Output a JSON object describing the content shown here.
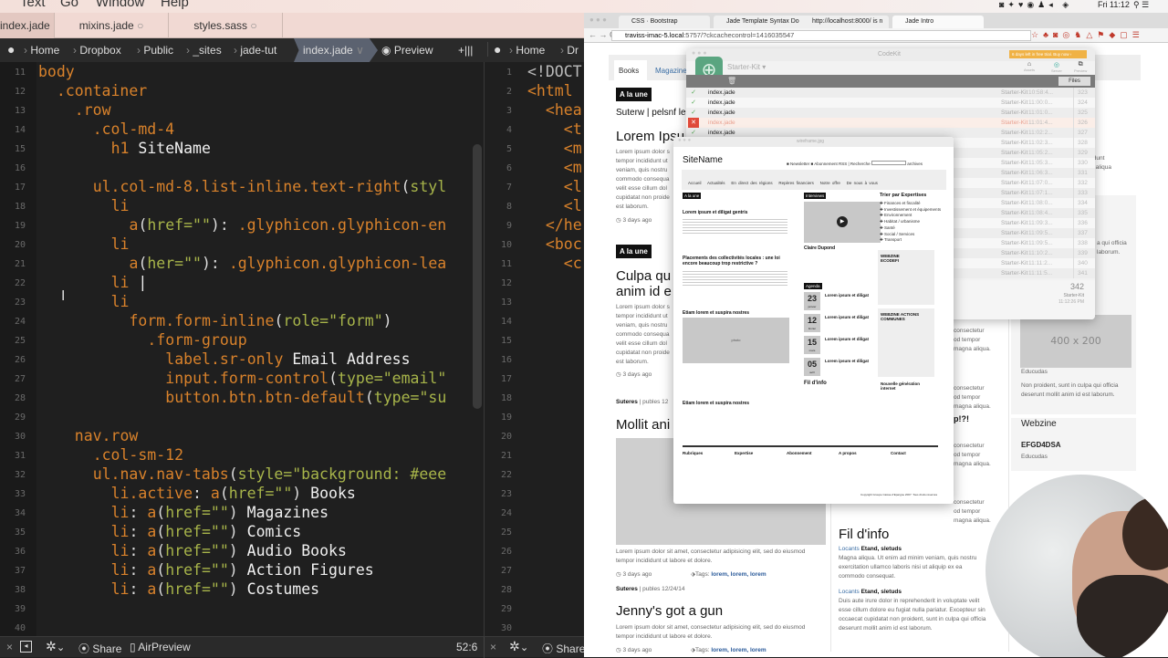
{
  "menubar": {
    "items": [
      "Text",
      "Go",
      "Window",
      "Help"
    ],
    "clock": "Fri 11:12"
  },
  "editor": {
    "tabs": [
      {
        "label": "index.jade",
        "status": "●"
      },
      {
        "label": "mixins.jade",
        "status": "○"
      },
      {
        "label": "styles.sass",
        "status": "○"
      }
    ],
    "breadcrumb": [
      "Home",
      "Dropbox",
      "Public",
      "_sites",
      "jade-tut",
      "index.jade"
    ],
    "preview_label": "Preview",
    "split_label": "+|||",
    "breadcrumb2": [
      "Home",
      "Dr"
    ],
    "lines": [
      {
        "n": 11,
        "i": 0,
        "t": [
          [
            "tag",
            "body"
          ]
        ]
      },
      {
        "n": 12,
        "i": 2,
        "t": [
          [
            "tag",
            ".container"
          ]
        ]
      },
      {
        "n": 13,
        "i": 4,
        "t": [
          [
            "tag",
            ".row"
          ]
        ]
      },
      {
        "n": 14,
        "i": 6,
        "t": [
          [
            "tag",
            ".col-md-4"
          ]
        ]
      },
      {
        "n": 15,
        "i": 8,
        "t": [
          [
            "tag",
            "h1"
          ],
          [
            "txt",
            " SiteName"
          ]
        ]
      },
      {
        "n": 16,
        "i": 0,
        "t": []
      },
      {
        "n": 17,
        "i": 6,
        "t": [
          [
            "tag",
            "ul.col-md-8.list-inline.text-right"
          ],
          [
            "p",
            "("
          ],
          [
            "attr",
            "styl"
          ]
        ]
      },
      {
        "n": 18,
        "i": 8,
        "t": [
          [
            "tag",
            "li"
          ]
        ]
      },
      {
        "n": 19,
        "i": 10,
        "t": [
          [
            "tag",
            "a"
          ],
          [
            "p",
            "("
          ],
          [
            "attr",
            "href="
          ],
          [
            "str",
            "\"\""
          ],
          [
            "p",
            "): "
          ],
          [
            "tag",
            ".glyphicon.glyphicon-en"
          ]
        ]
      },
      {
        "n": 20,
        "i": 8,
        "t": [
          [
            "tag",
            "li"
          ]
        ]
      },
      {
        "n": 21,
        "i": 10,
        "t": [
          [
            "tag",
            "a"
          ],
          [
            "p",
            "("
          ],
          [
            "attr",
            "her="
          ],
          [
            "str",
            "\"\""
          ],
          [
            "p",
            "): "
          ],
          [
            "tag",
            ".glyphicon.glyphicon-lea"
          ]
        ]
      },
      {
        "n": 22,
        "i": 8,
        "t": [
          [
            "tag",
            "li"
          ],
          [
            "txt",
            " |"
          ]
        ]
      },
      {
        "n": 23,
        "i": 8,
        "t": [
          [
            "tag",
            "li"
          ]
        ]
      },
      {
        "n": 24,
        "i": 10,
        "t": [
          [
            "tag",
            "form.form-inline"
          ],
          [
            "p",
            "("
          ],
          [
            "attr",
            "role="
          ],
          [
            "str",
            "\"form\""
          ],
          [
            "p",
            ")"
          ]
        ]
      },
      {
        "n": 25,
        "i": 12,
        "t": [
          [
            "tag",
            ".form-group"
          ]
        ]
      },
      {
        "n": 26,
        "i": 14,
        "t": [
          [
            "tag",
            "label.sr-only"
          ],
          [
            "txt",
            " Email Address"
          ]
        ]
      },
      {
        "n": 27,
        "i": 14,
        "t": [
          [
            "tag",
            "input.form-control"
          ],
          [
            "p",
            "("
          ],
          [
            "attr",
            "type="
          ],
          [
            "str",
            "\"email\""
          ]
        ]
      },
      {
        "n": 28,
        "i": 14,
        "t": [
          [
            "tag",
            "button.btn.btn-default"
          ],
          [
            "p",
            "("
          ],
          [
            "attr",
            "type="
          ],
          [
            "str",
            "\"su"
          ]
        ]
      },
      {
        "n": 29,
        "i": 0,
        "t": []
      },
      {
        "n": 30,
        "i": 4,
        "t": [
          [
            "tag",
            "nav.row"
          ]
        ]
      },
      {
        "n": 31,
        "i": 6,
        "t": [
          [
            "tag",
            ".col-sm-12"
          ]
        ]
      },
      {
        "n": 32,
        "i": 6,
        "t": [
          [
            "tag",
            "ul.nav.nav-tabs"
          ],
          [
            "p",
            "("
          ],
          [
            "attr",
            "style="
          ],
          [
            "str",
            "\"background: #eee"
          ]
        ]
      },
      {
        "n": 33,
        "i": 8,
        "t": [
          [
            "tag",
            "li.active"
          ],
          [
            "p",
            ": "
          ],
          [
            "tag",
            "a"
          ],
          [
            "p",
            "("
          ],
          [
            "attr",
            "href="
          ],
          [
            "str",
            "\"\""
          ],
          [
            "p",
            ")"
          ],
          [
            "txt",
            " Books"
          ]
        ]
      },
      {
        "n": 34,
        "i": 8,
        "t": [
          [
            "tag",
            "li"
          ],
          [
            "p",
            ": "
          ],
          [
            "tag",
            "a"
          ],
          [
            "p",
            "("
          ],
          [
            "attr",
            "href="
          ],
          [
            "str",
            "\"\""
          ],
          [
            "p",
            ")"
          ],
          [
            "txt",
            " Magazines"
          ]
        ]
      },
      {
        "n": 35,
        "i": 8,
        "t": [
          [
            "tag",
            "li"
          ],
          [
            "p",
            ": "
          ],
          [
            "tag",
            "a"
          ],
          [
            "p",
            "("
          ],
          [
            "attr",
            "href="
          ],
          [
            "str",
            "\"\""
          ],
          [
            "p",
            ")"
          ],
          [
            "txt",
            " Comics"
          ]
        ]
      },
      {
        "n": 36,
        "i": 8,
        "t": [
          [
            "tag",
            "li"
          ],
          [
            "p",
            ": "
          ],
          [
            "tag",
            "a"
          ],
          [
            "p",
            "("
          ],
          [
            "attr",
            "href="
          ],
          [
            "str",
            "\"\""
          ],
          [
            "p",
            ")"
          ],
          [
            "txt",
            " Audio Books"
          ]
        ]
      },
      {
        "n": 37,
        "i": 8,
        "t": [
          [
            "tag",
            "li"
          ],
          [
            "p",
            ": "
          ],
          [
            "tag",
            "a"
          ],
          [
            "p",
            "("
          ],
          [
            "attr",
            "href="
          ],
          [
            "str",
            "\"\""
          ],
          [
            "p",
            ")"
          ],
          [
            "txt",
            " Action Figures"
          ]
        ]
      },
      {
        "n": 38,
        "i": 8,
        "t": [
          [
            "tag",
            "li"
          ],
          [
            "p",
            ": "
          ],
          [
            "tag",
            "a"
          ],
          [
            "p",
            "("
          ],
          [
            "attr",
            "href="
          ],
          [
            "str",
            "\"\""
          ],
          [
            "p",
            ")"
          ],
          [
            "txt",
            " Costumes"
          ]
        ]
      },
      {
        "n": 39,
        "i": 0,
        "t": []
      },
      {
        "n": 40,
        "i": 0,
        "t": []
      }
    ],
    "lines2": [
      {
        "n": 1,
        "i": 0,
        "t": [
          [
            "gray",
            "<!DOCT"
          ]
        ]
      },
      {
        "n": 2,
        "i": 0,
        "t": [
          [
            "tag",
            "<html"
          ]
        ]
      },
      {
        "n": 3,
        "i": 2,
        "t": [
          [
            "tag",
            "<hea"
          ]
        ]
      },
      {
        "n": 4,
        "i": 4,
        "t": [
          [
            "tag",
            "<t"
          ]
        ]
      },
      {
        "n": 5,
        "i": 4,
        "t": [
          [
            "tag",
            "<m"
          ]
        ]
      },
      {
        "n": 6,
        "i": 4,
        "t": [
          [
            "tag",
            "<m"
          ]
        ]
      },
      {
        "n": 7,
        "i": 4,
        "t": [
          [
            "tag",
            "<l"
          ]
        ]
      },
      {
        "n": 8,
        "i": 4,
        "t": [
          [
            "tag",
            "<l"
          ]
        ]
      },
      {
        "n": 9,
        "i": 2,
        "t": [
          [
            "tag",
            "</he"
          ]
        ]
      },
      {
        "n": 10,
        "i": 2,
        "t": [
          [
            "tag",
            "<boc"
          ]
        ]
      },
      {
        "n": 11,
        "i": 4,
        "t": [
          [
            "tag",
            "<c"
          ]
        ]
      },
      {
        "n": 12,
        "i": 0,
        "t": []
      },
      {
        "n": 13,
        "i": 0,
        "t": []
      },
      {
        "n": 14,
        "i": 0,
        "t": []
      },
      {
        "n": 15,
        "i": 0,
        "t": []
      },
      {
        "n": 16,
        "i": 0,
        "t": []
      },
      {
        "n": 17,
        "i": 0,
        "t": []
      },
      {
        "n": 18,
        "i": 0,
        "t": []
      },
      {
        "n": 19,
        "i": 0,
        "t": []
      },
      {
        "n": 20,
        "i": 0,
        "t": []
      },
      {
        "n": 21,
        "i": 0,
        "t": []
      },
      {
        "n": 22,
        "i": 0,
        "t": []
      },
      {
        "n": 23,
        "i": 0,
        "t": []
      },
      {
        "n": 24,
        "i": 0,
        "t": []
      },
      {
        "n": 25,
        "i": 0,
        "t": []
      },
      {
        "n": 26,
        "i": 0,
        "t": []
      },
      {
        "n": 27,
        "i": 0,
        "t": []
      },
      {
        "n": 28,
        "i": 0,
        "t": []
      },
      {
        "n": 29,
        "i": 0,
        "t": []
      },
      {
        "n": 30,
        "i": 0,
        "t": []
      }
    ],
    "status": {
      "share": "Share",
      "airpreview": "AirPreview",
      "cursor": "52:6",
      "share2": "Share"
    }
  },
  "browser": {
    "tabs": [
      "CSS · Bootstrap",
      "Jade Template Syntax Doc",
      "http://localhost:8000/ is n",
      "Jade Intro"
    ],
    "url_host": "traviss-imac-5.local",
    "url_rest": ":5757/?ckcachecontrol=1416035547",
    "page": {
      "nav": [
        "Books",
        "Magazines"
      ],
      "badge": "A la une",
      "byline1": "Suterw | pelsnf le",
      "title1": "Lorem Ipsu",
      "lorem_lines": [
        "Lorem ipsum dolor s",
        "tempor incididunt ut",
        "veniam, quis nostru",
        "commodo consequa",
        "velit esse cillum dol",
        "cupidatat non proide",
        "est laborum."
      ],
      "ago": "3 days ago",
      "title2a": "Culpa qu",
      "title2b": "anim id e",
      "byline_author": "Suteres",
      "byline3": "| publes 12",
      "title3": "Mollit ani",
      "lorem_a": "Lorem ipsum dolor sit amet, consectetur adipisicing elit, sed do eiusmod",
      "lorem_b": "tempor incididunt ut labore et dolore.",
      "tags_label": "Tags:",
      "tags": "lorem, lorem, lorem",
      "byline4": "| publes 12/24/14",
      "title4": "Jenny's got a gun",
      "mid_frag": [
        "consectetur",
        "od tempor",
        "magna aliqua."
      ],
      "mid_q": "p!?!",
      "top_frag": [
        "cididunt",
        "gna aliqua"
      ],
      "right_frag": [
        "a qui officia",
        "laborum."
      ],
      "fil_title": "Fil d'info",
      "locants": "Locants",
      "etand": "Etand, sletuds",
      "fil1": [
        "Magna aliqua. Ut enim ad minim veniam, quis nostru",
        "exercitation ullamco laboris nisi ut aliquip ex ea",
        "commodo consequat."
      ],
      "fil2": [
        "Duis aute irure dolor in reprehenderit in voluptate velit",
        "esse cillum dolore eu fugiat nulla pariatur. Excepteur sin",
        "occaecat cupidatat non proident, sunt in culpa qui officia",
        "deserunt mollit anim id est laborum."
      ],
      "placeholder": "400 x 200",
      "educudas": "Educudas",
      "non_proident": [
        "Non proident, sunt in culpa qui officia",
        "deserunt mollit anim id est laborum."
      ],
      "webzine": "Webzine",
      "webzine_code": "EFGD4DSA"
    }
  },
  "codekit": {
    "title": "CodeKit",
    "trial": "6 days left in free trial. Buy now ›",
    "project": "Starter-Kit ▾",
    "actions": [
      "Assets",
      "Server",
      "Preview"
    ],
    "files_label": "Files",
    "file": "index.jade",
    "rows": [
      {
        "num": "323",
        "time": "10:58:4...",
        "ok": true
      },
      {
        "num": "324",
        "time": "11:00:0...",
        "ok": true
      },
      {
        "num": "325",
        "time": "11:01:0...",
        "ok": true
      },
      {
        "num": "326",
        "time": "11:01:4...",
        "ok": false
      },
      {
        "num": "327",
        "time": "11:02:2...",
        "ok": true
      },
      {
        "num": "328",
        "time": "11:02:3...",
        "ok": true
      },
      {
        "num": "329",
        "time": "11:05:2...",
        "ok": true
      },
      {
        "num": "330",
        "time": "11:05:3...",
        "ok": true
      },
      {
        "num": "331",
        "time": "11:06:3...",
        "ok": true
      },
      {
        "num": "332",
        "time": "11:07:0...",
        "ok": true
      },
      {
        "num": "333",
        "time": "11:07:1...",
        "ok": true
      },
      {
        "num": "334",
        "time": "11:08:0...",
        "ok": true
      },
      {
        "num": "335",
        "time": "11:08:4...",
        "ok": true
      },
      {
        "num": "336",
        "time": "11:09:3...",
        "ok": true
      },
      {
        "num": "337",
        "time": "11:09:5...",
        "ok": true
      },
      {
        "num": "338",
        "time": "11:09:5...",
        "ok": true
      },
      {
        "num": "339",
        "time": "11:10:2...",
        "ok": true
      },
      {
        "num": "340",
        "time": "11:11:2...",
        "ok": true
      },
      {
        "num": "341",
        "time": "11:11:5...",
        "ok": true
      }
    ],
    "project_name": "Starter-Kit",
    "latest_num": "342",
    "latest_time": "11:12:26 PM"
  },
  "wireframe": {
    "title": "wireframe.jpg",
    "site": "SiteName",
    "top_links": [
      "Newsletter",
      "Abonnement RSS",
      "Recherche",
      "archives"
    ],
    "nav": [
      "Accueil",
      "Actualités",
      "En direct des régions",
      "Repères financiers",
      "Notre offre",
      "De nous à vous"
    ],
    "a_la_une": "A la une",
    "interviews": "Interviews",
    "experts": "Trier par Expertises",
    "expert_list": [
      "Finances et fiscalité",
      "Investissement et équipements",
      "Environnement",
      "Habitat / urbanisme",
      "Santé",
      "Social / Services",
      "Transport"
    ],
    "h1": "Lorem ipsum et diligat gentris",
    "h2": "Placements des collectivités locales : une loi encore beaucoup trop restrictive ?",
    "h3": "Etiam lorem et suspira nostres",
    "h4": "Etiam lorem et suspira nostres",
    "claire": "Claire Dupond",
    "agenda": "Agenda",
    "dates": [
      {
        "d": "23",
        "m": "janvier"
      },
      {
        "d": "12",
        "m": "février"
      },
      {
        "d": "15",
        "m": "mars"
      },
      {
        "d": "05",
        "m": "avril"
      }
    ],
    "agenda_item": "Lorem ipsum et diligat",
    "webzine1": "WEBZINE ECODEFI",
    "webzine2": "WEBZINE ACTIONS COMMUNES",
    "fil": "Fil d'info",
    "photo": "photo",
    "nouvelle": "Nouvelle génération internet",
    "footer": [
      "Rubriques",
      "Expertise",
      "Abonnement",
      "A propos",
      "Contact"
    ],
    "copyright": "Copyright Groupe Caisse d'Epargne 2007. Tous droits réservés"
  }
}
